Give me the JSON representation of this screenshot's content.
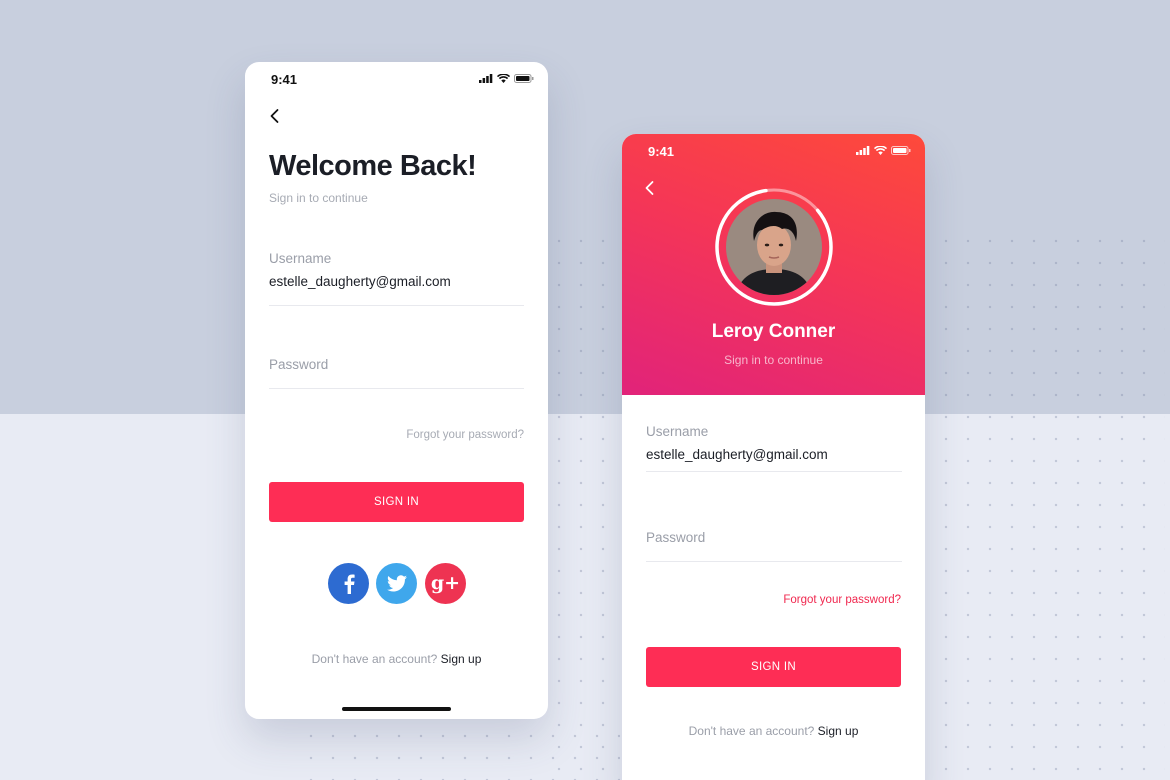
{
  "left_screen": {
    "status_time": "9:41",
    "title": "Welcome Back!",
    "subtitle": "Sign in to continue",
    "username_label": "Username",
    "username_value": "estelle_daugherty@gmail.com",
    "password_label": "Password",
    "forgot": "Forgot your password?",
    "sign_in": "SIGN IN",
    "social": [
      {
        "name": "facebook-icon",
        "glyph": "f",
        "color": "#2d6bd1"
      },
      {
        "name": "twitter-icon",
        "glyph": "",
        "color": "#3fa7ec"
      },
      {
        "name": "google-plus-icon",
        "glyph": "g+",
        "color": "#ee3352"
      }
    ],
    "no_account": "Don't have an account?",
    "sign_up": "Sign up"
  },
  "right_screen": {
    "status_time": "9:41",
    "name": "Leroy Conner",
    "subtitle": "Sign in to continue",
    "username_label": "Username",
    "username_value": "estelle_daugherty@gmail.com",
    "password_label": "Password",
    "forgot": "Forgot your password?",
    "sign_in": "SIGN IN",
    "no_account": "Don't have an account?",
    "sign_up": "Sign up"
  },
  "colors": {
    "accent": "#fe2d55",
    "gradient_top": "#fe4a3a",
    "gradient_bottom": "#e8246e",
    "background_top": "#c8cfde",
    "background_bottom": "#e8ebf4"
  }
}
